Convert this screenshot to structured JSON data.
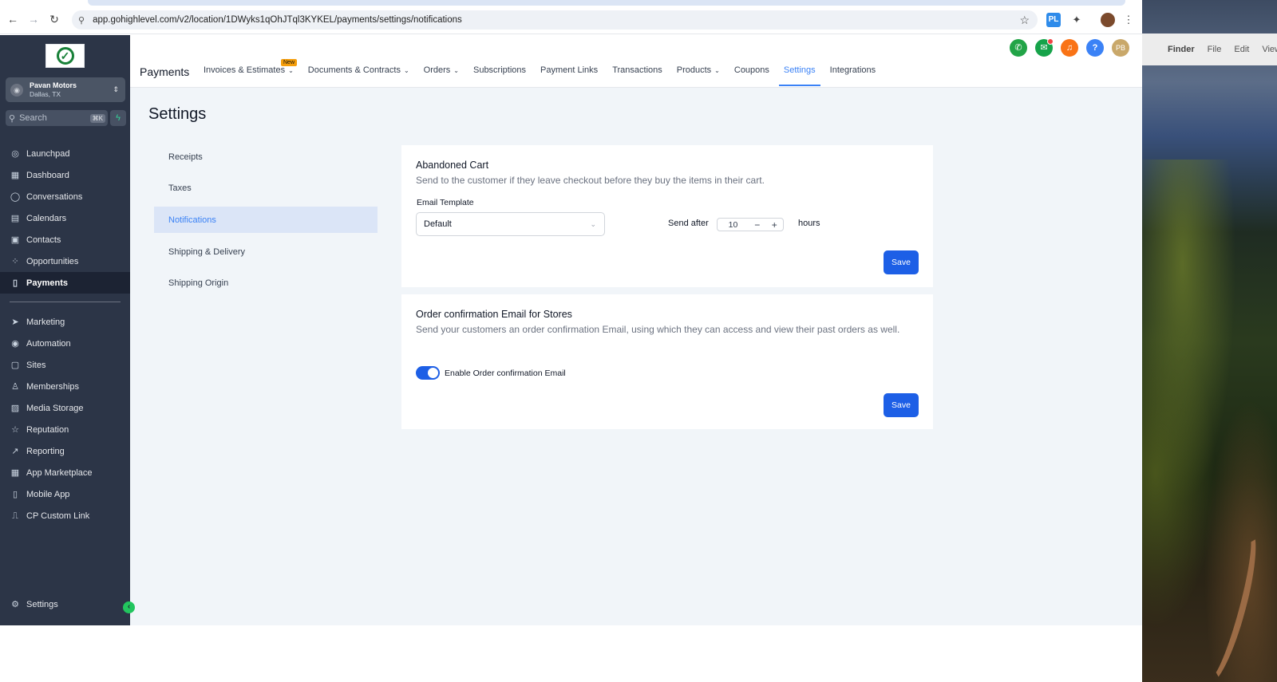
{
  "browser": {
    "url": "app.gohighlevel.com/v2/location/1DWyks1qOhJTql3KYKEL/payments/settings/notifications",
    "back_icon": "←",
    "forward_icon": "→",
    "reload_icon": "↻",
    "star_icon": "☆",
    "ext_label": "PL",
    "more_icon": "⋮"
  },
  "desktop": {
    "apple": "",
    "finder": "Finder",
    "file": "File",
    "edit": "Edit",
    "view": "View"
  },
  "sidebar": {
    "account_name": "Pavan Motors",
    "account_location": "Dallas, TX",
    "search_placeholder": "Search",
    "search_shortcut": "⌘K",
    "nav_top": [
      {
        "label": "Launchpad",
        "icon": "rocket-icon",
        "glyph": "◎"
      },
      {
        "label": "Dashboard",
        "icon": "grid-icon",
        "glyph": "▦"
      },
      {
        "label": "Conversations",
        "icon": "chat-icon",
        "glyph": "◯"
      },
      {
        "label": "Calendars",
        "icon": "calendar-icon",
        "glyph": "▤"
      },
      {
        "label": "Contacts",
        "icon": "contacts-icon",
        "glyph": "▣"
      },
      {
        "label": "Opportunities",
        "icon": "opportunities-icon",
        "glyph": "⁘"
      },
      {
        "label": "Payments",
        "icon": "payments-icon",
        "glyph": "▯"
      }
    ],
    "nav_bottom": [
      {
        "label": "Marketing",
        "icon": "send-icon",
        "glyph": "➤"
      },
      {
        "label": "Automation",
        "icon": "automation-icon",
        "glyph": "◉"
      },
      {
        "label": "Sites",
        "icon": "sites-icon",
        "glyph": "▢"
      },
      {
        "label": "Memberships",
        "icon": "memberships-icon",
        "glyph": "♙"
      },
      {
        "label": "Media Storage",
        "icon": "media-icon",
        "glyph": "▨"
      },
      {
        "label": "Reputation",
        "icon": "star-icon",
        "glyph": "☆"
      },
      {
        "label": "Reporting",
        "icon": "trend-icon",
        "glyph": "↗"
      },
      {
        "label": "App Marketplace",
        "icon": "apps-icon",
        "glyph": "▦"
      },
      {
        "label": "Mobile App",
        "icon": "mobile-icon",
        "glyph": "▯"
      },
      {
        "label": "CP Custom Link",
        "icon": "link-icon",
        "glyph": "⎍"
      }
    ],
    "settings_label": "Settings",
    "settings_glyph": "⚙"
  },
  "topnav": {
    "section": "Payments",
    "new_badge": "New",
    "tabs": [
      {
        "label": "Invoices & Estimates",
        "caret": "⌄"
      },
      {
        "label": "Documents & Contracts",
        "caret": "⌄"
      },
      {
        "label": "Orders",
        "caret": "⌄"
      },
      {
        "label": "Subscriptions",
        "caret": ""
      },
      {
        "label": "Payment Links",
        "caret": ""
      },
      {
        "label": "Transactions",
        "caret": ""
      },
      {
        "label": "Products",
        "caret": "⌄"
      },
      {
        "label": "Coupons",
        "caret": ""
      },
      {
        "label": "Settings",
        "caret": ""
      },
      {
        "label": "Integrations",
        "caret": ""
      }
    ],
    "avatar_initials": "PB",
    "colors": {
      "phone": "#22a447",
      "megaphone": "#16a34a",
      "bell": "#f97316",
      "help": "#3b82f6",
      "avatar": "#c9a86a"
    }
  },
  "page": {
    "title": "Settings",
    "submenu": [
      "Receipts",
      "Taxes",
      "Notifications",
      "Shipping & Delivery",
      "Shipping Origin"
    ]
  },
  "abandoned_cart": {
    "title": "Abandoned Cart",
    "description": "Send to the customer if they leave checkout before they buy the items in their cart.",
    "email_template_label": "Email Template",
    "email_template_value": "Default",
    "send_after_label": "Send after",
    "send_after_value": "10",
    "hours_label": "hours",
    "save_label": "Save"
  },
  "order_confirmation": {
    "title": "Order confirmation Email for Stores",
    "description": "Send your customers an order confirmation Email, using which they can access and view their past orders as well.",
    "toggle_label": "Enable Order confirmation Email",
    "toggle_on": true,
    "save_label": "Save"
  }
}
